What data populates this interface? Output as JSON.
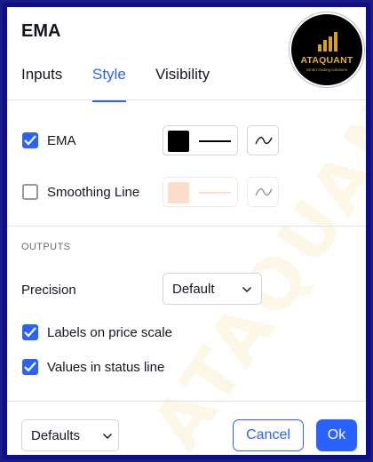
{
  "dialog": {
    "title": "EMA"
  },
  "logo": {
    "brand": "ATAQUANT",
    "tagline": "Smart trading solutions"
  },
  "watermark": "ATAQUANT",
  "tabs": [
    {
      "label": "Inputs",
      "active": false
    },
    {
      "label": "Style",
      "active": true
    },
    {
      "label": "Visibility",
      "active": false
    }
  ],
  "plots": [
    {
      "label": "EMA",
      "checked": true,
      "color": "#000000",
      "line_color": "#000000",
      "enabled": true
    },
    {
      "label": "Smoothing Line",
      "checked": false,
      "color": "#f7b78a",
      "line_color": "#f7b78a",
      "enabled": false
    }
  ],
  "outputs": {
    "heading": "OUTPUTS",
    "precision_label": "Precision",
    "precision_value": "Default",
    "labels_on_price_scale": {
      "label": "Labels on price scale",
      "checked": true
    },
    "values_in_status_line": {
      "label": "Values in status line",
      "checked": true
    }
  },
  "footer": {
    "defaults_label": "Defaults",
    "cancel_label": "Cancel",
    "ok_label": "Ok"
  },
  "colors": {
    "accent": "#2962ff",
    "frame": "#0d0d8f",
    "logo_gold": "#d6a021"
  }
}
